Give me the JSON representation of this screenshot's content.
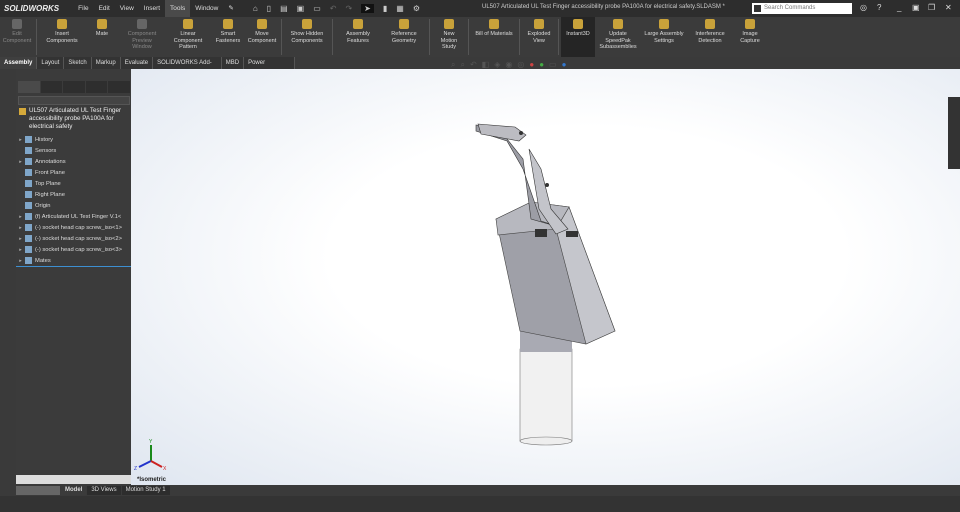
{
  "app": {
    "logo": "SOLIDWORKS",
    "document_title": "UL507 Articulated UL Test Finger accessibility probe PA100A for electrical safety.SLDASM *"
  },
  "menu": [
    "File",
    "Edit",
    "View",
    "Insert",
    "Tools",
    "Window"
  ],
  "search": {
    "placeholder": "Search Commands"
  },
  "ribbon": [
    {
      "label": "Edit Component",
      "disabled": true
    },
    {
      "label": "Insert Components"
    },
    {
      "label": "Mate"
    },
    {
      "label": "Component Preview Window",
      "disabled": true
    },
    {
      "label": "Linear Component Pattern"
    },
    {
      "label": "Smart Fasteners"
    },
    {
      "label": "Move Component"
    },
    {
      "label": "Show Hidden Components"
    },
    {
      "label": "Assembly Features"
    },
    {
      "label": "Reference Geometry"
    },
    {
      "label": "New Motion Study"
    },
    {
      "label": "Bill of Materials"
    },
    {
      "label": "Exploded View"
    },
    {
      "label": "Instant3D",
      "active": true
    },
    {
      "label": "Update SpeedPak Subassemblies"
    },
    {
      "label": "Large Assembly Settings"
    },
    {
      "label": "Interference Detection"
    },
    {
      "label": "Image Capture"
    }
  ],
  "tabs": [
    "Assembly",
    "Layout",
    "Sketch",
    "Markup",
    "Evaluate",
    "SOLIDWORKS Add-Ins",
    "MBD",
    "Power Surfacing"
  ],
  "tree": {
    "root": "UL507 Articulated UL Test Finger accessibility probe PA100A for electrical safety",
    "items": [
      {
        "label": "History",
        "expand": true
      },
      {
        "label": "Sensors"
      },
      {
        "label": "Annotations",
        "expand": true
      },
      {
        "label": "Front Plane"
      },
      {
        "label": "Top Plane"
      },
      {
        "label": "Right Plane"
      },
      {
        "label": "Origin"
      },
      {
        "label": "(f) Articulated UL Test Finger V.1<",
        "expand": true
      },
      {
        "label": "(-) socket head cap screw_iso<1>",
        "expand": true
      },
      {
        "label": "(-) socket head cap screw_iso<2>",
        "expand": true
      },
      {
        "label": "(-) socket head cap screw_iso<3>",
        "expand": true
      },
      {
        "label": "Mates",
        "expand": true
      }
    ]
  },
  "view": {
    "orientation": "*Isometric",
    "triad": {
      "x": "X",
      "y": "Y",
      "z": "Z"
    }
  },
  "bottom_tabs": [
    "Model",
    "3D Views",
    "Motion Study 1"
  ],
  "colors": {
    "accent": "#3d8fd1",
    "active_tab": "#252525"
  }
}
